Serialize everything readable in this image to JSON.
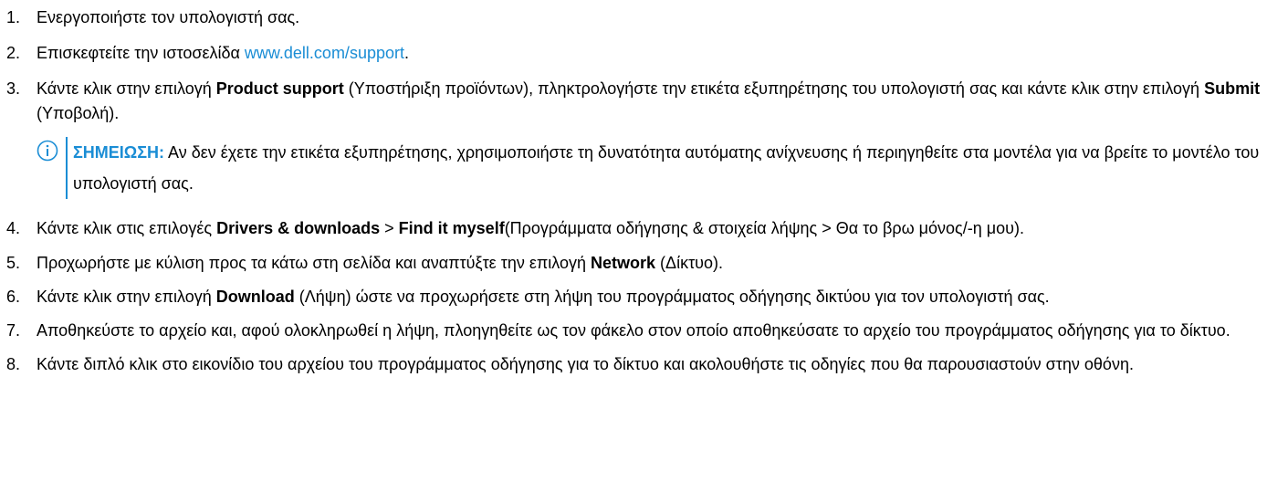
{
  "steps": [
    {
      "num": "1.",
      "text": "Ενεργοποιήστε τον υπολογιστή σας."
    },
    {
      "num": "2.",
      "before": "Επισκεφτείτε την ιστοσελίδα ",
      "link": "www.dell.com/support",
      "after": "."
    },
    {
      "num": "3.",
      "pre": "Κάντε κλικ στην επιλογή ",
      "b1": "Product support",
      "mid": " (Υποστήριξη προϊόντων), πληκτρολογήστε την ετικέτα εξυπηρέτησης του υπολογιστή σας και κάντε κλικ στην επιλογή ",
      "b2": "Submit",
      "post": " (Υποβολή).",
      "note_label": "ΣΗΜΕΙΩΣΗ:",
      "note_text": " Αν δεν έχετε την ετικέτα εξυπηρέτησης, χρησιμοποιήστε τη δυνατότητα αυτόματης ανίχνευσης ή περιηγηθείτε στα μοντέλα για να βρείτε το μοντέλο του υπολογιστή σας."
    },
    {
      "num": "4.",
      "pre": "Κάντε κλικ στις επιλογές ",
      "b1": "Drivers & downloads",
      "mid": " > ",
      "b2": "Find it myself",
      "post": "(Προγράμματα οδήγησης & στοιχεία λήψης > Θα το βρω μόνος/-η μου)."
    },
    {
      "num": "5.",
      "pre": "Προχωρήστε με κύλιση προς τα κάτω στη σελίδα και αναπτύξτε την επιλογή ",
      "b1": "Network",
      "post": " (Δίκτυο)."
    },
    {
      "num": "6.",
      "pre": "Κάντε κλικ στην επιλογή ",
      "b1": "Download",
      "post": " (Λήψη) ώστε να προχωρήσετε στη λήψη του προγράμματος οδήγησης δικτύου για τον υπολογιστή σας."
    },
    {
      "num": "7.",
      "text": "Αποθηκεύστε το αρχείο και, αφού ολοκληρωθεί η λήψη, πλοηγηθείτε ως τον φάκελο στον οποίο αποθηκεύσατε το αρχείο του προγράμματος οδήγησης για το δίκτυο."
    },
    {
      "num": "8.",
      "text": "Κάντε διπλό κλικ στο εικονίδιο του αρχείου του προγράμματος οδήγησης για το δίκτυο και ακολουθήστε τις οδηγίες που θα παρουσιαστούν στην οθόνη."
    }
  ],
  "note_icon": "info-icon",
  "colors": {
    "accent": "#1a8dd5",
    "text": "#000000"
  }
}
